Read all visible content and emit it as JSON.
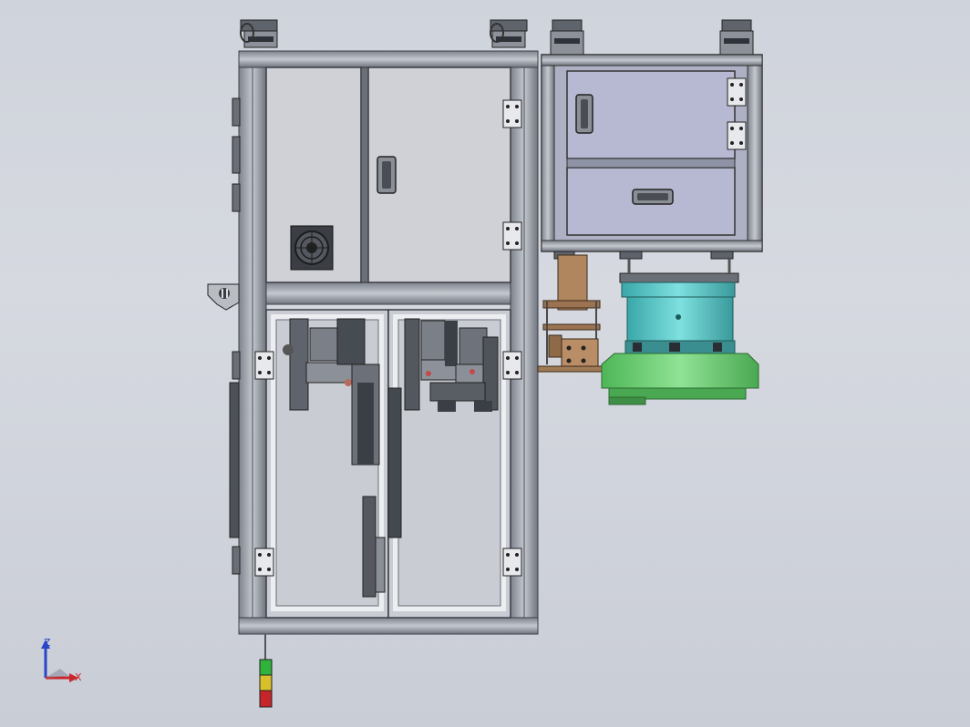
{
  "viewport": {
    "background": "#d0d4dc",
    "colors": {
      "frame": "#9ea3ad",
      "frame_dark": "#5d626b",
      "panel": "#cfd1d6",
      "glass": "#c8ccd3",
      "cabinet": "#b7b9d2",
      "bronze": "#b0865e",
      "teal": "#4fc0c0",
      "green": "#6bcf72",
      "light_red": "#c6262a",
      "light_yellow": "#d8c02b",
      "light_green": "#2fb33a"
    }
  },
  "triad": {
    "z_label": "Z",
    "x_label": "X",
    "z_color": "#2b45c9",
    "x_color": "#c8282c"
  },
  "signal_tower": {
    "segments": [
      "green",
      "yellow",
      "red"
    ]
  }
}
